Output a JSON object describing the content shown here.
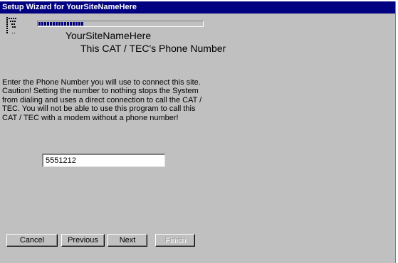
{
  "window": {
    "title": "Setup Wizard for YourSiteNameHere"
  },
  "wizard": {
    "progress_fraction": 0.28,
    "site_name": "YourSiteNameHere",
    "page_title": "This CAT / TEC's Phone Number",
    "description": "Enter the Phone Number you will use to connect this site. Caution!          Setting the number  to nothing stops the System from dialing and uses a direct connection to call the CAT / TEC.  You will not be able to use this program to call this CAT / TEC with a modem without a phone number!"
  },
  "phone": {
    "value": "5551212"
  },
  "buttons": {
    "cancel": "Cancel",
    "previous": "Previous",
    "next": "Next",
    "finish": "Finish"
  },
  "icons": {
    "logo": "wizard-logo-icon"
  },
  "colors": {
    "titlebar": "#000080",
    "face": "#c0c0c0",
    "progress": "#000080"
  }
}
